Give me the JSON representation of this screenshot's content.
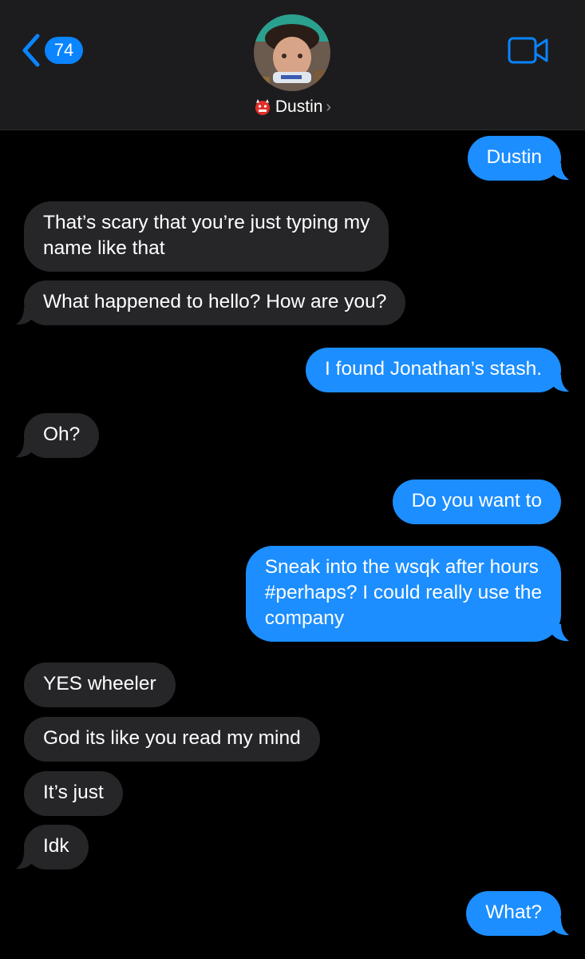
{
  "header": {
    "back_count": "74",
    "contact_name": "Dustin",
    "contact_emoji": "ogre-emoji",
    "avatar": "contact-photo",
    "video_icon": "video-camera-icon",
    "back_icon": "chevron-left-icon"
  },
  "colors": {
    "accent": "#0a84ff",
    "outgoing_bubble": "#1c8eff",
    "incoming_bubble": "#262629",
    "header_bg": "#1c1c1e",
    "background": "#000000"
  },
  "messages": [
    {
      "dir": "out",
      "lines": [
        "Dustin"
      ]
    },
    {
      "dir": "in",
      "lines": [
        "That’s scary that you’re just typing my",
        "name like that"
      ]
    },
    {
      "dir": "in",
      "lines": [
        "What happened to hello? How are you?"
      ]
    },
    {
      "dir": "out",
      "lines": [
        "I found Jonathan’s stash."
      ]
    },
    {
      "dir": "in",
      "lines": [
        "Oh?"
      ]
    },
    {
      "dir": "out",
      "lines": [
        "Do you want to"
      ]
    },
    {
      "dir": "out",
      "lines": [
        "Sneak into the wsqk after hours",
        "#perhaps? I could really use the",
        "company"
      ]
    },
    {
      "dir": "in",
      "lines": [
        "YES wheeler"
      ]
    },
    {
      "dir": "in",
      "lines": [
        "God its like you read my mind"
      ]
    },
    {
      "dir": "in",
      "lines": [
        "It’s just"
      ]
    },
    {
      "dir": "in",
      "lines": [
        "Idk"
      ]
    },
    {
      "dir": "out",
      "lines": [
        "What?"
      ]
    }
  ]
}
